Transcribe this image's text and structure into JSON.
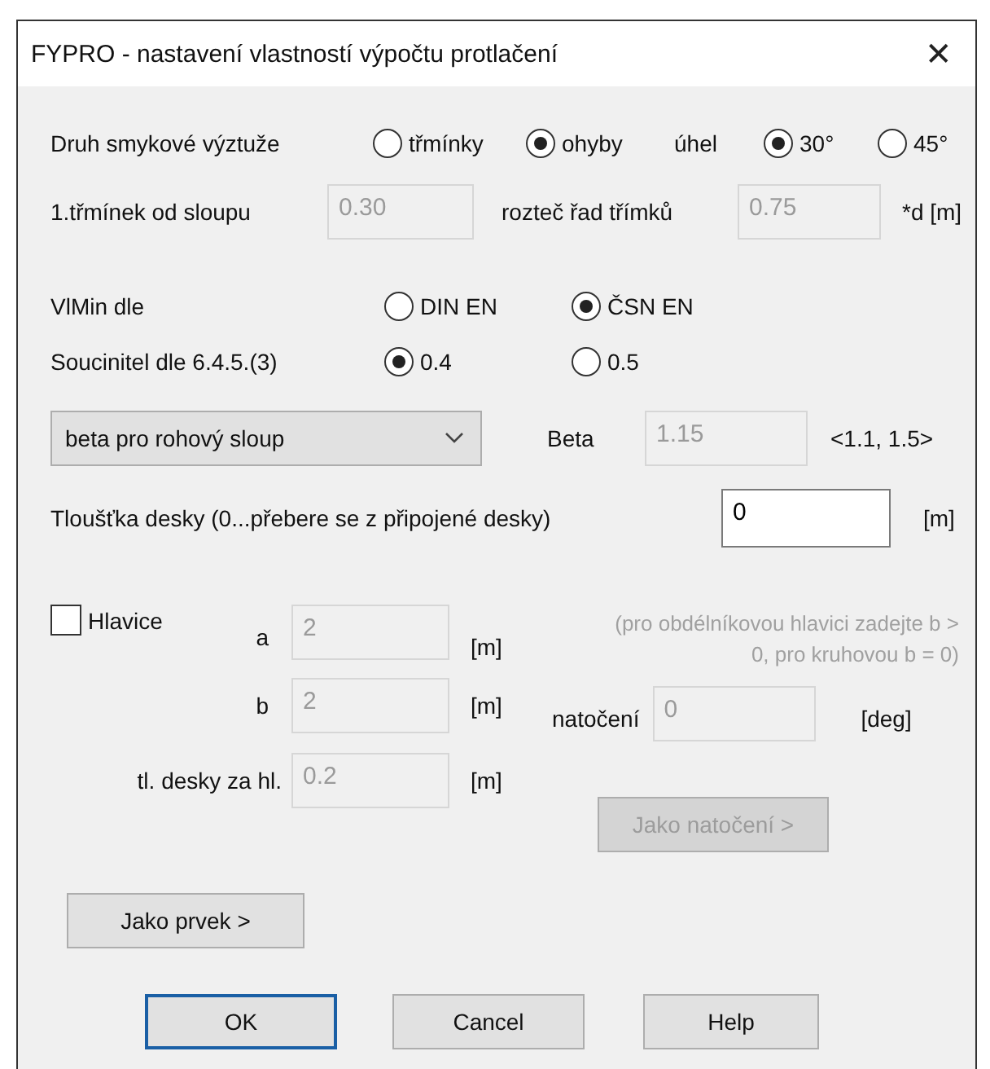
{
  "window": {
    "title": "FYPRO - nastavení vlastností výpočtu protlačení",
    "close": "✕"
  },
  "shear_type": {
    "label": "Druh smykové výztuže",
    "options": [
      {
        "label": "třmínky",
        "selected": false
      },
      {
        "label": "ohyby",
        "selected": true
      }
    ],
    "angle_label": "úhel",
    "angles": [
      {
        "label": "30°",
        "selected": true
      },
      {
        "label": "45°",
        "selected": false
      }
    ]
  },
  "stirrups": {
    "first_label": "1.třmínek od sloupu",
    "first_value": "0.30",
    "spacing_label": "rozteč řad třímků",
    "spacing_value": "0.75",
    "unit": "*d [m]",
    "disabled": true
  },
  "vmin": {
    "label": "VlMin dle",
    "options": [
      {
        "label": "DIN EN",
        "selected": false
      },
      {
        "label": "ČSN EN",
        "selected": true
      }
    ]
  },
  "coefficient": {
    "label": "Soucinitel dle 6.4.5.(3)",
    "options": [
      {
        "label": "0.4",
        "selected": true
      },
      {
        "label": "0.5",
        "selected": false
      }
    ]
  },
  "beta": {
    "dropdown": "beta pro rohový sloup",
    "label": "Beta",
    "value": "1.15",
    "range": "<1.1, 1.5>",
    "disabled": true
  },
  "thickness": {
    "label": "Tloušťka desky (0...přebere se z připojené desky)",
    "value": "0",
    "unit": "[m]"
  },
  "head": {
    "label": "Hlavice",
    "checked": false,
    "fields": [
      {
        "label": "a",
        "value": "2",
        "unit": "[m]"
      },
      {
        "label": "b",
        "value": "2",
        "unit": "[m]"
      },
      {
        "label": "tl. desky za hl.",
        "value": "0.2",
        "unit": "[m]"
      }
    ],
    "note": "(pro obdélníkovou hlavici zadejte b > 0, pro kruhovou b = 0)",
    "rotation": {
      "label": "natočení",
      "value": "0",
      "unit": "[deg]"
    },
    "rotation_button": {
      "label": "Jako natočení >",
      "disabled": true
    }
  },
  "as_element_button": "Jako prvek >",
  "buttons": [
    {
      "label": "OK",
      "default": true
    },
    {
      "label": "Cancel",
      "default": false
    },
    {
      "label": "Help",
      "default": false
    }
  ]
}
